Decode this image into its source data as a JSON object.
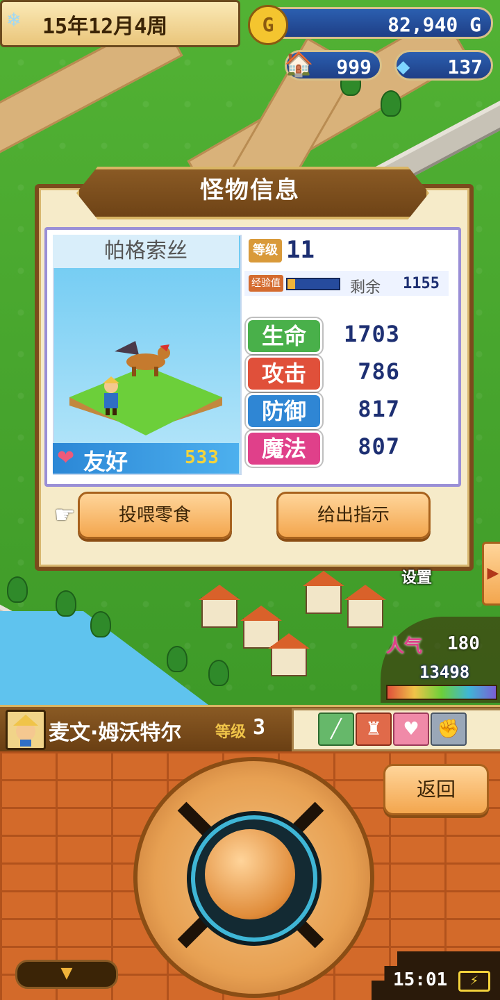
{
  "hud": {
    "date": "15年12月4周",
    "gold": "82,940 G",
    "houses": "999",
    "crystals": "137"
  },
  "dialog": {
    "title": "怪物信息",
    "monster_name": "帕格索丝",
    "level_label": "等级",
    "level": "11",
    "exp_label": "经验值",
    "exp_remaining_label": "剩余",
    "exp_remaining": "1155",
    "exp_fill_fraction": 0.15,
    "friendship_label": "友好",
    "friendship_value": "533",
    "stats": [
      {
        "label": "生命",
        "value": "1703",
        "color": "#49b04a"
      },
      {
        "label": "攻击",
        "value": "786",
        "color": "#e0503a"
      },
      {
        "label": "防御",
        "value": "817",
        "color": "#2f86d4"
      },
      {
        "label": "魔法",
        "value": "807",
        "color": "#e0408a"
      }
    ],
    "buttons": {
      "feed": "投喂零食",
      "command": "给出指示"
    }
  },
  "map": {
    "settings_label": "设置",
    "popularity_label": "人气",
    "popularity_value": "180",
    "score": "13498"
  },
  "character": {
    "name": "麦文·姆沃特尔",
    "level_label": "等级",
    "level": "3",
    "equipment_icons": [
      "staff-icon",
      "armor-icon",
      "heart-accessory-icon",
      "gauntlet-icon"
    ]
  },
  "controls": {
    "back_label": "返回",
    "collapse_glyph": "▼"
  },
  "status": {
    "time": "15:01",
    "battery_glyph": "⚡"
  },
  "colors": {
    "dialog_bg": "#f6ebc9",
    "dialog_border": "#7b4b1c",
    "accent_blue": "#1d2f72",
    "brick": "#d36a2a"
  }
}
